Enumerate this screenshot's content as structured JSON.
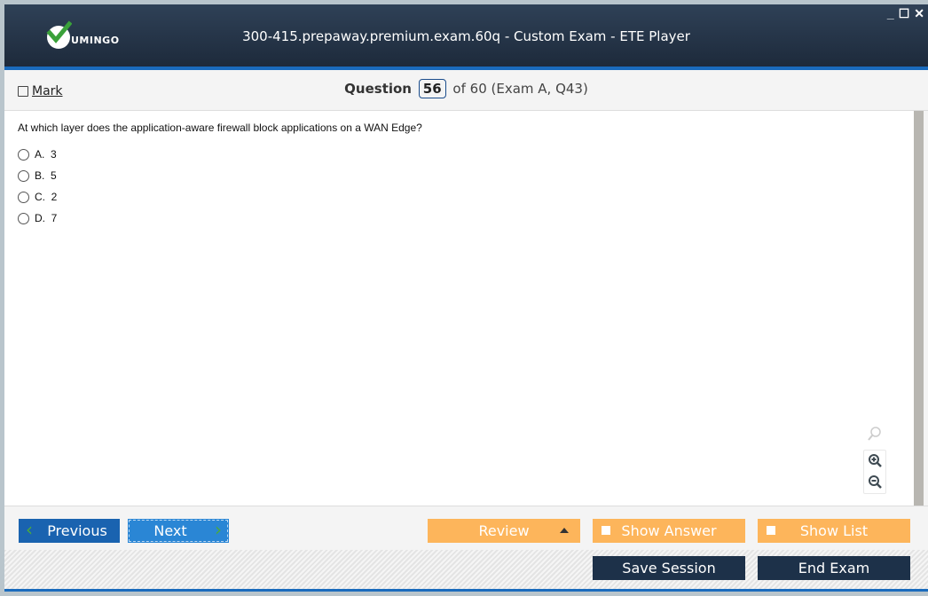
{
  "titlebar": {
    "logo_text": "UMINGO",
    "title": "300-415.prepaway.premium.exam.60q - Custom Exam - ETE Player",
    "controls": {
      "minimize": "_",
      "maximize": "☐",
      "close": "✕"
    }
  },
  "question_bar": {
    "mark_label": "Mark",
    "mark_checked": false,
    "question_label": "Question",
    "question_number": "56",
    "question_suffix": "of 60 (Exam A, Q43)"
  },
  "question": {
    "text": "At which layer does the application-aware firewall block applications on a WAN Edge?",
    "options": [
      {
        "letter": "A.",
        "value": "3"
      },
      {
        "letter": "B.",
        "value": "5"
      },
      {
        "letter": "C.",
        "value": "2"
      },
      {
        "letter": "D.",
        "value": "7"
      }
    ]
  },
  "zoom_tools": {
    "icons": [
      "search-icon",
      "zoom-in-icon",
      "zoom-out-icon"
    ]
  },
  "nav": {
    "previous_label": "Previous",
    "next_label": "Next",
    "review_label": "Review",
    "show_answer_label": "Show Answer",
    "show_list_label": "Show List"
  },
  "footer": {
    "save_session_label": "Save Session",
    "end_exam_label": "End Exam"
  },
  "colors": {
    "titlebar": "#1d2a3b",
    "accent_blue": "#1a6bbd",
    "orange": "#fdb55b",
    "dark_button": "#1d3149",
    "check_green": "#3aa13a"
  }
}
